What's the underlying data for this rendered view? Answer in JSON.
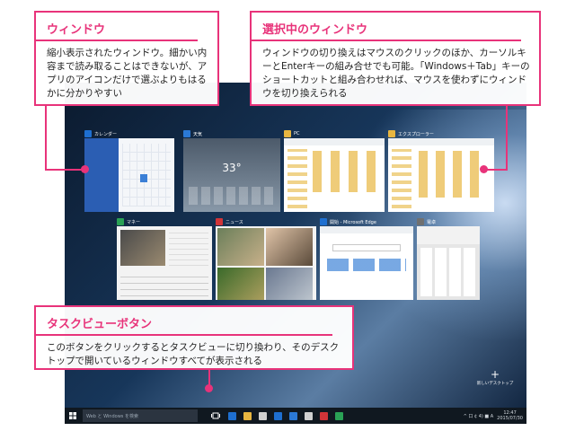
{
  "callouts": {
    "window": {
      "title": "ウィンドウ",
      "text": "縮小表示されたウィンドウ。細かい内容まで読み取ることはできないが、アプリのアイコンだけで選ぶよりもはるかに分かりやすい"
    },
    "selected": {
      "title": "選択中のウィンドウ",
      "text": "ウィンドウの切り換えはマウスのクリックのほか、カーソルキーとEnterキーの組み合せでも可能。「Windows＋Tab」キーのショートカットと組み合わせれば、マウスを使わずにウィンドウを切り換えられる"
    },
    "taskview": {
      "title": "タスクビューボタン",
      "text": "このボタンをクリックするとタスクビューに切り換わり、そのデスクトップで開いているウィンドウすべてが表示される"
    }
  },
  "windows": [
    {
      "title": "カレンダー",
      "icon_color": "#1e6fd0"
    },
    {
      "title": "天気",
      "icon_color": "#2b79d6"
    },
    {
      "title": "PC",
      "icon_color": "#e8b640"
    },
    {
      "title": "エクスプローラー",
      "icon_color": "#e8b640"
    },
    {
      "title": "マネー",
      "icon_color": "#2aa155"
    },
    {
      "title": "ニュース",
      "icon_color": "#d13438"
    },
    {
      "title": "開始 - Microsoft Edge",
      "icon_color": "#1e6fd0"
    },
    {
      "title": "電卓",
      "icon_color": "#707070"
    }
  ],
  "weather": {
    "temp": "33°"
  },
  "new_desktop": {
    "label": "新しいデスクトップ",
    "symbol": "+"
  },
  "taskbar": {
    "search_placeholder": "Web と Windows を検索",
    "time": "12:47",
    "date": "2015/07/30",
    "tray_text": "^ 口 ¢ 4) ■ A",
    "app_colors": [
      "#1e6fd0",
      "#e8b640",
      "#d0d0d0",
      "#1e6fd0",
      "#2b79d6",
      "#d0d0d0",
      "#d13438",
      "#2aa155"
    ]
  }
}
